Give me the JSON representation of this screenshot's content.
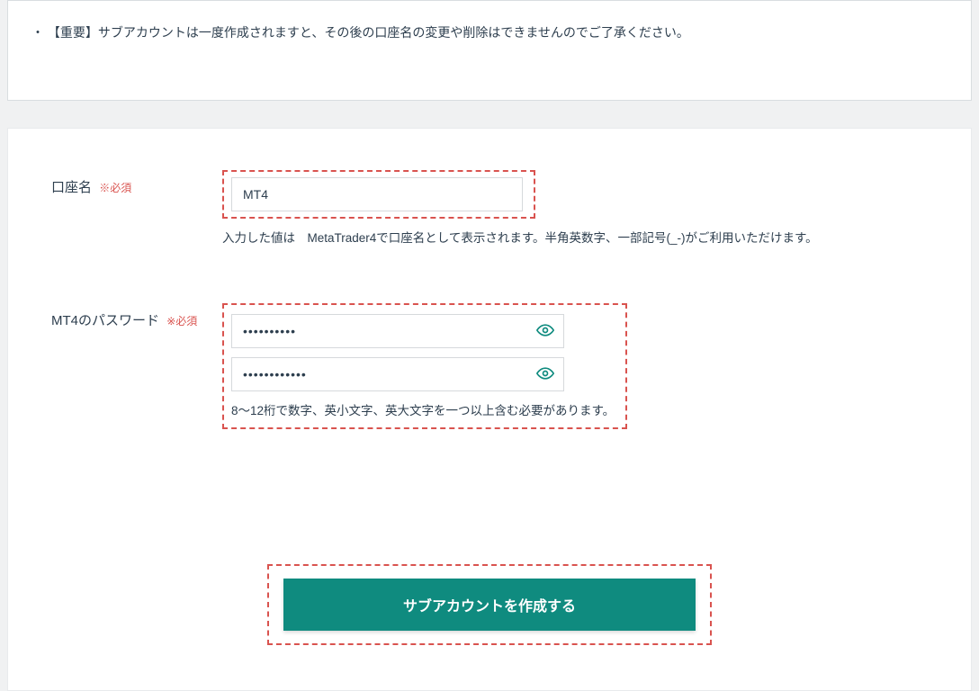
{
  "notice": {
    "text": "・ 【重要】サブアカウントは一度作成されますと、その後の口座名の変更や削除はできませんのでご了承ください。"
  },
  "form": {
    "account_name": {
      "label": "口座名",
      "required_text": "※必須",
      "value": "MT4",
      "help": "入力した値は　MetaTrader4で口座名として表示されます。半角英数字、一部記号(_-)がご利用いただけます。"
    },
    "password": {
      "label": "MT4のパスワード",
      "required_text": "※必須",
      "value1": "••••••••••",
      "value2": "••••••••••••",
      "help": "8～12桁で数字、英小文字、英大文字を一つ以上含む必要があります。"
    },
    "submit_label": "サブアカウントを作成する"
  }
}
